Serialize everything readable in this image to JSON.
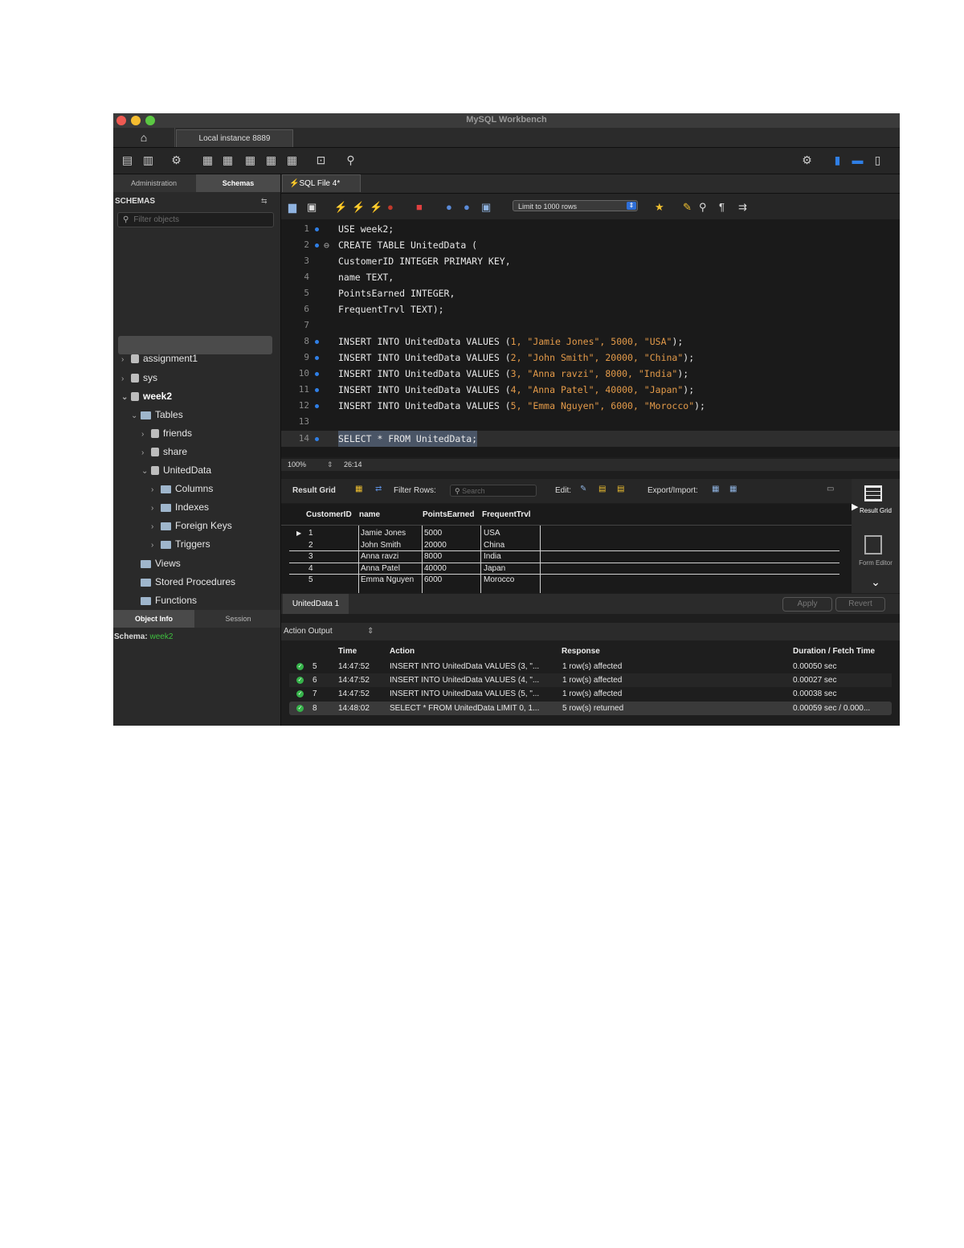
{
  "window": {
    "title": "MySQL Workbench"
  },
  "tabs": {
    "connection": "Local instance 8889",
    "sql_file": "SQL File 4*"
  },
  "left_panel": {
    "tabs": [
      "Administration",
      "Schemas"
    ],
    "header": "SCHEMAS",
    "filter_placeholder": "Filter objects",
    "tree": [
      {
        "label": "assignment1"
      },
      {
        "label": "sys"
      },
      {
        "label": "week2"
      },
      {
        "label": "Tables"
      },
      {
        "label": "friends"
      },
      {
        "label": "share"
      },
      {
        "label": "UnitedData"
      },
      {
        "label": "Columns"
      },
      {
        "label": "Indexes"
      },
      {
        "label": "Foreign Keys"
      },
      {
        "label": "Triggers"
      },
      {
        "label": "Views"
      },
      {
        "label": "Stored Procedures"
      },
      {
        "label": "Functions"
      }
    ],
    "bottom_tabs": [
      "Object Info",
      "Session"
    ],
    "schema_label": "Schema:",
    "schema_value": "week2"
  },
  "sql_toolbar": {
    "limit": "Limit to 1000 rows"
  },
  "editor": {
    "lines": [
      {
        "n": "1",
        "text": "USE week2;"
      },
      {
        "n": "2",
        "text": "CREATE TABLE UnitedData ("
      },
      {
        "n": "3",
        "text": "CustomerID INTEGER PRIMARY KEY,"
      },
      {
        "n": "4",
        "text": "name TEXT,"
      },
      {
        "n": "5",
        "text": "PointsEarned INTEGER,"
      },
      {
        "n": "6",
        "text": "FrequentTrvl TEXT);"
      },
      {
        "n": "7",
        "text": ""
      },
      {
        "n": "8",
        "pre": "INSERT INTO UnitedData VALUES (",
        "vals": "1, \"Jamie Jones\", 5000, \"USA\"",
        "post": ");"
      },
      {
        "n": "9",
        "pre": "INSERT INTO UnitedData VALUES (",
        "vals": "2, \"John Smith\", 20000, \"China\"",
        "post": ");"
      },
      {
        "n": "10",
        "pre": "INSERT INTO UnitedData VALUES (",
        "vals": "3, \"Anna ravzi\", 8000, \"India\"",
        "post": ");"
      },
      {
        "n": "11",
        "pre": "INSERT INTO UnitedData VALUES (",
        "vals": "4, \"Anna Patel\", 40000, \"Japan\"",
        "post": ");"
      },
      {
        "n": "12",
        "pre": "INSERT INTO UnitedData VALUES (",
        "vals": "5, \"Emma Nguyen\", 6000, \"Morocco\"",
        "post": ");"
      },
      {
        "n": "13",
        "text": ""
      },
      {
        "n": "14",
        "text": "SELECT * FROM UnitedData;"
      }
    ],
    "zoom": "100%",
    "cursor": "26:14"
  },
  "result": {
    "title": "Result Grid",
    "filter_label": "Filter Rows:",
    "search_placeholder": "Search",
    "edit_label": "Edit:",
    "export_label": "Export/Import:",
    "columns": [
      "CustomerID",
      "name",
      "PointsEarned",
      "FrequentTrvl"
    ],
    "rows": [
      [
        "1",
        "Jamie Jones",
        "5000",
        "USA"
      ],
      [
        "2",
        "John Smith",
        "20000",
        "China"
      ],
      [
        "3",
        "Anna ravzi",
        "8000",
        "India"
      ],
      [
        "4",
        "Anna Patel",
        "40000",
        "Japan"
      ],
      [
        "5",
        "Emma Nguyen",
        "6000",
        "Morocco"
      ]
    ],
    "side_result_grid": "Result Grid",
    "side_form_editor": "Form Editor",
    "result_tab": "UnitedData 1",
    "apply": "Apply",
    "revert": "Revert"
  },
  "action_output": {
    "title": "Action Output",
    "columns": [
      "Time",
      "Action",
      "Response",
      "Duration / Fetch Time"
    ],
    "rows": [
      {
        "n": "5",
        "time": "14:47:52",
        "action": "INSERT INTO UnitedData VALUES (3, \"...",
        "response": "1 row(s) affected",
        "duration": "0.00050 sec"
      },
      {
        "n": "6",
        "time": "14:47:52",
        "action": "INSERT INTO UnitedData VALUES (4, \"...",
        "response": "1 row(s) affected",
        "duration": "0.00027 sec"
      },
      {
        "n": "7",
        "time": "14:47:52",
        "action": "INSERT INTO UnitedData VALUES (5, \"...",
        "response": "1 row(s) affected",
        "duration": "0.00038 sec"
      },
      {
        "n": "8",
        "time": "14:48:02",
        "action": "SELECT * FROM UnitedData LIMIT 0, 1...",
        "response": "5 row(s) returned",
        "duration": "0.00059 sec / 0.000..."
      }
    ]
  }
}
